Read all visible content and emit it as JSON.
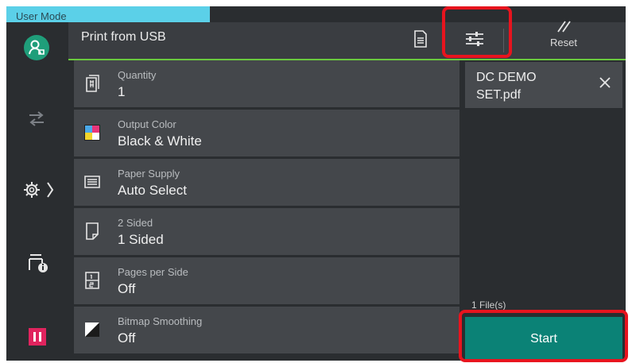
{
  "mode": {
    "label": "User Mode"
  },
  "header": {
    "title": "Print from USB",
    "reset_label": "Reset",
    "icons": [
      "document-icon",
      "settings-sliders-icon",
      "reset-icon"
    ]
  },
  "rail": {
    "items": [
      "user-icon",
      "job-flow-icon",
      "device-settings-icon",
      "printer-info-icon",
      "stop-icon"
    ]
  },
  "settings": [
    {
      "label": "Quantity",
      "value": "1",
      "icon": "quantity-icon"
    },
    {
      "label": "Output Color",
      "value": "Black & White",
      "icon": "output-color-icon"
    },
    {
      "label": "Paper Supply",
      "value": "Auto Select",
      "icon": "paper-supply-icon"
    },
    {
      "label": "2 Sided",
      "value": "1 Sided",
      "icon": "two-sided-icon"
    },
    {
      "label": "Pages per Side",
      "value": "Off",
      "icon": "pages-per-side-icon"
    },
    {
      "label": "Bitmap Smoothing",
      "value": "Off",
      "icon": "bitmap-smoothing-icon"
    }
  ],
  "file": {
    "name": "DC DEMO SET.pdf",
    "count_label": "1 File(s)"
  },
  "start": {
    "label": "Start"
  },
  "colors": {
    "accent_green": "#6ac93e",
    "start_teal": "#0b8276",
    "highlight_red": "#e8141e",
    "mode_cyan": "#5bd0e8",
    "stop_pink": "#e0245e"
  }
}
